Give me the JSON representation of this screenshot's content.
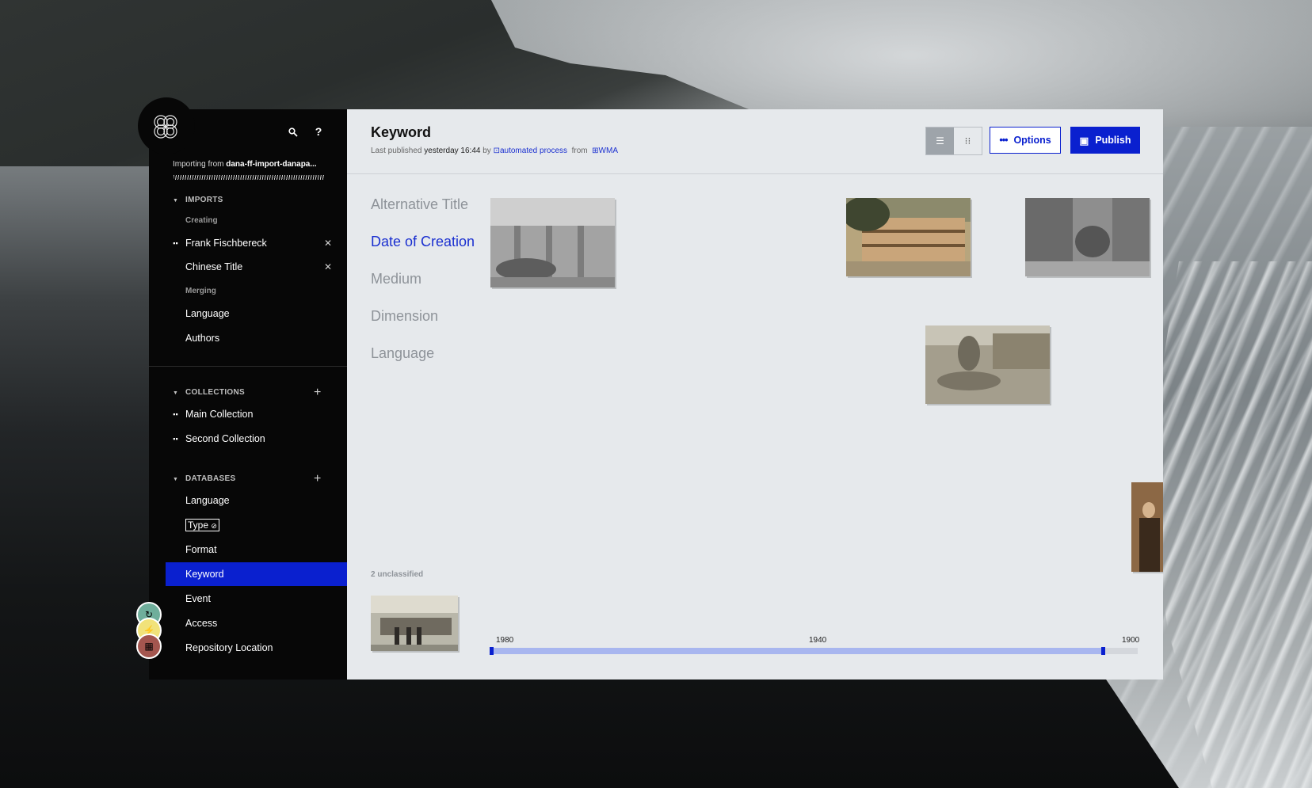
{
  "app": {
    "importing_prefix": "Importing from",
    "importing_source": "dana-ff-import-danapa..."
  },
  "sidebar": {
    "imports_heading": "IMPORTS",
    "creating_label": "Creating",
    "creating_items": [
      {
        "label": "Frank Fischbereck",
        "icon": "grid-icon"
      },
      {
        "label": "Chinese Title",
        "icon": ""
      }
    ],
    "merging_label": "Merging",
    "merging_items": [
      {
        "label": "Language"
      },
      {
        "label": "Authors"
      }
    ],
    "collections_heading": "COLLECTIONS",
    "collections": [
      {
        "label": "Main Collection"
      },
      {
        "label": "Second Collection"
      }
    ],
    "databases_heading": "DATABASES",
    "databases": [
      {
        "label": "Language"
      },
      {
        "label": "Type"
      },
      {
        "label": "Format"
      },
      {
        "label": "Keyword",
        "active": true
      },
      {
        "label": "Event"
      },
      {
        "label": "Access"
      },
      {
        "label": "Repository Location"
      }
    ]
  },
  "main": {
    "title": "Keyword",
    "meta": {
      "prefix": "Last published",
      "when": "yesterday 16:44",
      "by": "by",
      "author": "automated process",
      "from": "from",
      "source": "WMA"
    },
    "options_label": "Options",
    "publish_label": "Publish",
    "facets": [
      {
        "label": "Alternative Title"
      },
      {
        "label": "Date of Creation",
        "selected": true
      },
      {
        "label": "Medium"
      },
      {
        "label": "Dimension"
      },
      {
        "label": "Language"
      }
    ],
    "unclassified_label": "2 unclassified",
    "timeline": {
      "ticks": [
        "1980",
        "1940",
        "1900"
      ],
      "selected_range_fraction": [
        0,
        0.95
      ]
    }
  },
  "colors": {
    "accent": "#0a20cf",
    "sidebar_bg": "#070707",
    "main_bg": "#e6e9ec"
  }
}
